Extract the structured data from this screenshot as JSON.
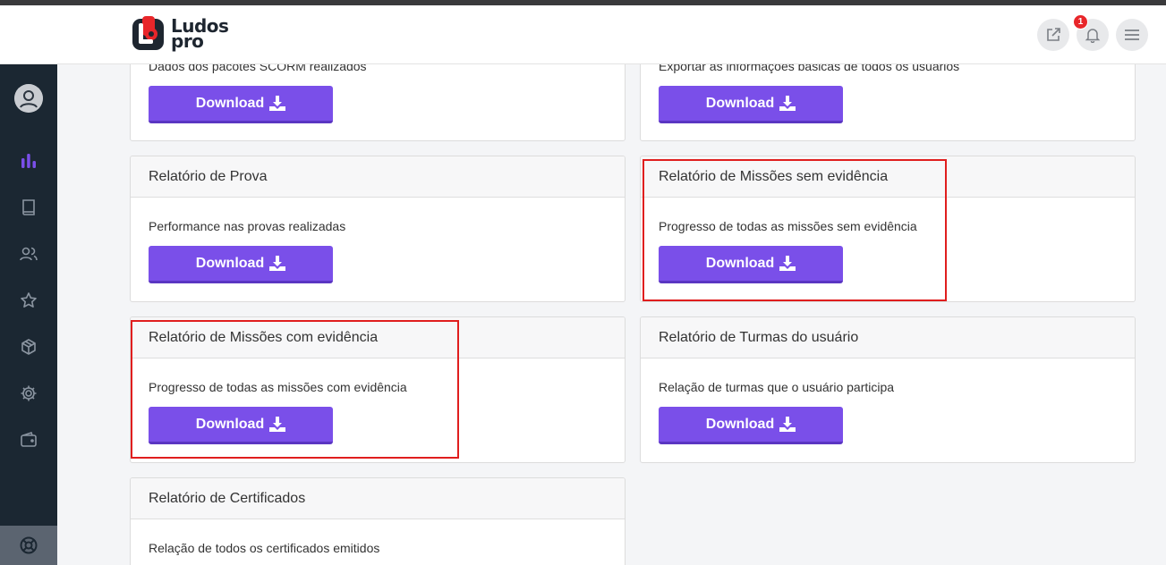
{
  "brand": {
    "logo_line1": "Ludos",
    "logo_line2": "pro"
  },
  "header": {
    "notification_count": "1"
  },
  "sidebar": {
    "icons": [
      "user-avatar",
      "chart-icon",
      "book-icon",
      "users-icon",
      "star-icon",
      "box-icon",
      "gear-icon",
      "wallet-icon",
      "support-icon"
    ],
    "active_color": "#7a4fe9"
  },
  "cards": [
    {
      "title": "",
      "desc": "Dados dos pacotes SCORM realizados",
      "button": "Download"
    },
    {
      "title": "",
      "desc": "Exportar as informações básicas de todos os usuários",
      "button": "Download"
    },
    {
      "title": "Relatório de Prova",
      "desc": "Performance nas provas realizadas",
      "button": "Download"
    },
    {
      "title": "Relatório de Missões sem evidência",
      "desc": "Progresso de todas as missões sem evidência",
      "button": "Download"
    },
    {
      "title": "Relatório de Missões com evidência",
      "desc": "Progresso de todas as missões com evidência",
      "button": "Download"
    },
    {
      "title": "Relatório de Turmas do usuário",
      "desc": "Relação de turmas que o usuário participa",
      "button": "Download"
    },
    {
      "title": "Relatório de Certificados",
      "desc": "Relação de todos os certificados emitidos",
      "button": "Download"
    }
  ],
  "colors": {
    "accent": "#7a4fe9",
    "highlight": "#e01e1e",
    "sidebar": "#1b2732"
  }
}
